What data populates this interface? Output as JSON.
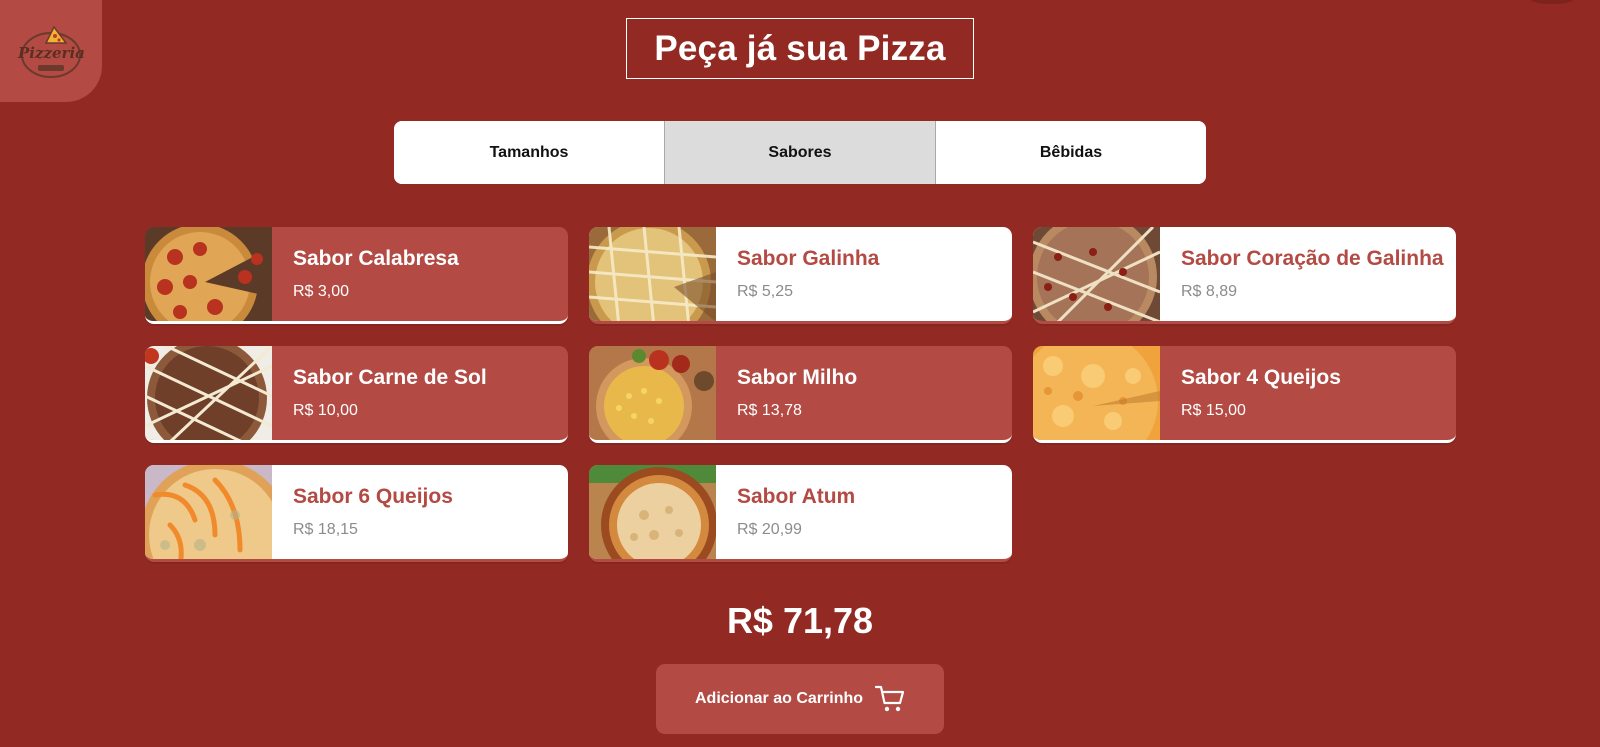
{
  "header": {
    "title": "Peça já sua Pizza",
    "logo_text": "Pizzeria"
  },
  "tabs": [
    {
      "label": "Tamanhos",
      "active": false
    },
    {
      "label": "Sabores",
      "active": true
    },
    {
      "label": "Bêbidas",
      "active": false
    }
  ],
  "flavors": [
    {
      "name": "Sabor Calabresa",
      "price": "R$ 3,00",
      "selected": true,
      "image": "pepperoni-pizza"
    },
    {
      "name": "Sabor Galinha",
      "price": "R$ 5,25",
      "selected": false,
      "image": "chicken-pizza"
    },
    {
      "name": "Sabor Coração de Galinha",
      "price": "R$ 8,89",
      "selected": false,
      "image": "chicken-heart-pizza"
    },
    {
      "name": "Sabor Carne de Sol",
      "price": "R$ 10,00",
      "selected": true,
      "image": "carne-de-sol-pizza"
    },
    {
      "name": "Sabor Milho",
      "price": "R$ 13,78",
      "selected": true,
      "image": "corn-pizza"
    },
    {
      "name": "Sabor 4 Queijos",
      "price": "R$ 15,00",
      "selected": true,
      "image": "four-cheese-pizza"
    },
    {
      "name": "Sabor 6 Queijos",
      "price": "R$ 18,15",
      "selected": false,
      "image": "six-cheese-pizza"
    },
    {
      "name": "Sabor Atum",
      "price": "R$ 20,99",
      "selected": false,
      "image": "tuna-pizza"
    }
  ],
  "total": "R$ 71,78",
  "cart_button": {
    "label": "Adicionar ao Carrinho",
    "icon": "cart-icon"
  },
  "colors": {
    "background": "#922a23",
    "accent": "#b34a43",
    "tab_active": "#dcdcdc",
    "text_light": "#ffffff"
  }
}
